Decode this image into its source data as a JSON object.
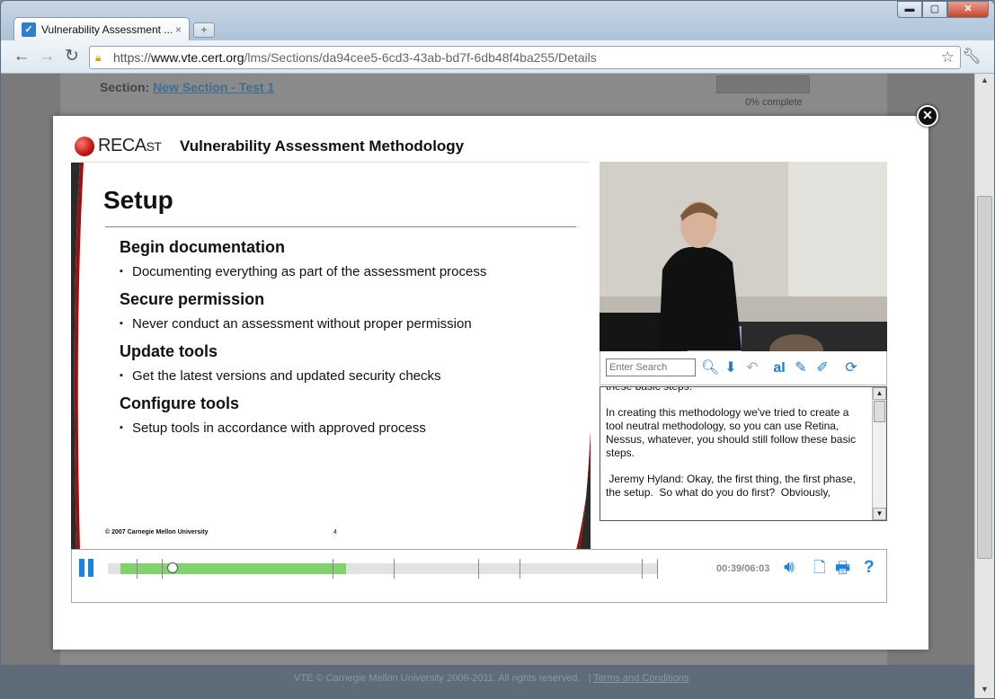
{
  "browser": {
    "tab_title": "Vulnerability Assessment ...",
    "tab_close": "×",
    "new_tab": "+",
    "url_scheme": "https://",
    "url_host": "www.vte.cert.org",
    "url_path": "/lms/Sections/da94cee5-6cd3-43ab-bd7f-6db48f4ba255/Details",
    "window_controls": {
      "minimize": "▬",
      "maximize": "▢",
      "close": "✕"
    }
  },
  "background_page": {
    "section_label": "Section:",
    "section_link": "New Section - Test 1",
    "progress_text": "0% complete",
    "footer_text": "VTE © Carnegie Mellon University 2006-2011. All rights reserved.",
    "footer_separator": "|",
    "footer_link": "Terms and Conditions"
  },
  "modal": {
    "close_glyph": "✕",
    "logo_rec": "REC",
    "logo_ast": "AST",
    "logo_ast_initial": "A",
    "course_title": "Vulnerability Assessment Methodology",
    "slide": {
      "heading": "Setup",
      "sections": [
        {
          "title": "Begin documentation",
          "bullet": "Documenting everything as part of the assessment process"
        },
        {
          "title": "Secure permission",
          "bullet": "Never conduct an assessment without proper permission"
        },
        {
          "title": "Update tools",
          "bullet": "Get the latest versions and updated security checks"
        },
        {
          "title": "Configure tools",
          "bullet": "Setup tools in accordance with approved process"
        }
      ],
      "copyright": "© 2007 Carnegie Mellon University",
      "page_number": "4"
    },
    "search": {
      "placeholder": "Enter Search",
      "tools": [
        "search-icon",
        "download-icon",
        "undo-icon",
        "text-size-icon",
        "pencil-icon",
        "eraser-icon",
        "refresh-icon"
      ]
    },
    "transcript": {
      "top_fragment": "these basic steps.",
      "paragraph1": "In creating this methodology we've tried to create a tool neutral methodology, so you can use Retina, Nessus, whatever, you should still follow these basic steps.",
      "paragraph2": " Jeremy Hyland: Okay, the first thing, the first phase, the setup.  So what do you do first?  Obviously,"
    },
    "player": {
      "time": "00:39/06:03",
      "progress_percent": 41,
      "state": "playing"
    }
  }
}
